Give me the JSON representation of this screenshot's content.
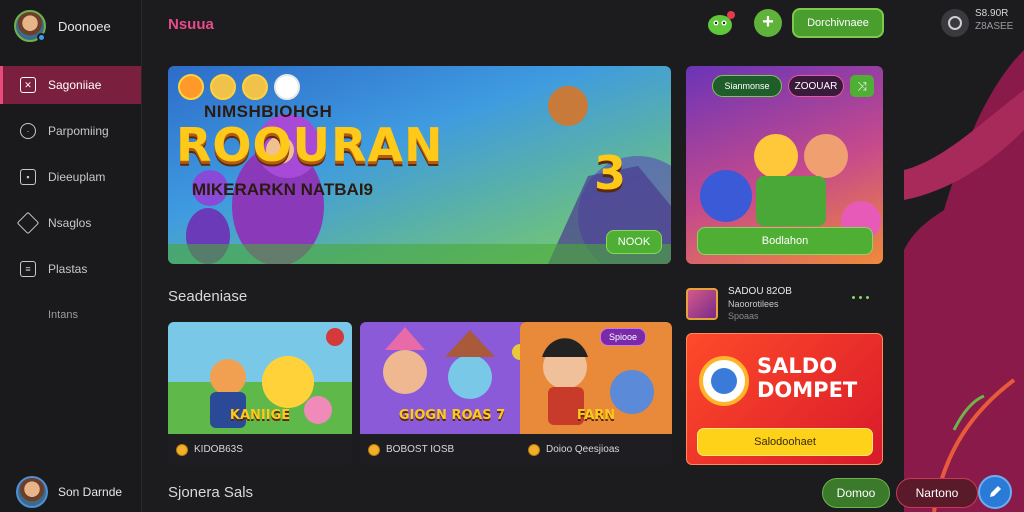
{
  "profile": {
    "name": "Doonoee"
  },
  "header": {
    "title": "Nsuua",
    "cta_label": "Dorchivnaee",
    "balance_line1": "S8.90R",
    "balance_line2": "Z8ASEE"
  },
  "sidebar": {
    "items": [
      {
        "label": "Sagoniiae",
        "icon": "home-icon"
      },
      {
        "label": "Parpomiing",
        "icon": "gamepad-icon"
      },
      {
        "label": "Dieeuplam",
        "icon": "grid-icon"
      },
      {
        "label": "Nsaglos",
        "icon": "tag-icon"
      },
      {
        "label": "Plastas",
        "icon": "list-icon"
      },
      {
        "label": "Intans",
        "icon": ""
      }
    ],
    "footer_name": "Son Darnde"
  },
  "hero": {
    "line1": "NIMSHBIOHGH",
    "title": "ROOURAN",
    "number": "3",
    "line2": "MIKERARKN NATBAI9",
    "button": "NOOK"
  },
  "promo": {
    "chip1": "Sianmonse",
    "chip2": "ZOOUAR",
    "button": "Bodlahon"
  },
  "section": {
    "title": "Seadeniase"
  },
  "cards": [
    {
      "art_label": "KANIIGE",
      "footer": "KIDOB63S",
      "badge": ""
    },
    {
      "art_label": "GIOGN ROAS 7",
      "footer": "BOBOST IOSB",
      "badge": ""
    },
    {
      "art_label": "FARN",
      "footer": "Doioo Qeesjioas",
      "badge": "Spiooe"
    }
  ],
  "saldo": {
    "line1": "SADOU 82OB",
    "line2": "Naoorotilees",
    "line3": "Spoaas"
  },
  "wallet": {
    "title_line1": "SALDO",
    "title_line2": "DOMPET",
    "button": "Salodoohaet"
  },
  "bottom": {
    "section_title": "Sjonera Sals",
    "btn_green": "Domoo",
    "btn_red": "Nartono"
  }
}
